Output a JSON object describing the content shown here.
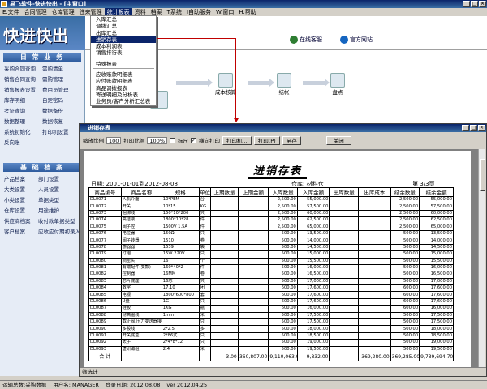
{
  "window": {
    "title": "易飞软件-快进快出 - [主窗口]"
  },
  "menu": [
    "E.文件",
    "合同管理",
    "仓库管理",
    "往来管理",
    "统计报表",
    "资料",
    "档案",
    "T系统",
    "I自助服务",
    "W.窗口",
    "H.帮助"
  ],
  "logo": "快进快出",
  "banner": {
    "service": "在线客服",
    "website": "官方网站"
  },
  "dropdown": {
    "group1": [
      "入库汇总",
      "调拨汇总",
      "出库汇总",
      "进销存表",
      "成本利润表",
      "销售排行表"
    ],
    "group2": [
      "特殊报表"
    ],
    "group3": [
      "应收账款明细表",
      "应付账款明细表",
      "商品调拨报表",
      "寄送明细及分析表",
      "业务员/客户分析汇总表"
    ],
    "selected": "进销存表"
  },
  "sidebar": {
    "daily_title": "日 常 业 务",
    "daily_items": [
      "采购合同查询",
      "需购清单",
      "销售合同查询",
      "需购管理",
      "销售报表设置",
      "费用员管理",
      "库存明细",
      "自定密码",
      "考证查询",
      "数据备份",
      "数据整理",
      "数据恢复",
      "系统初始化",
      "打印机设置",
      "反向账"
    ],
    "basic_title": "基 础 档 案",
    "basic_items": [
      "产品档案",
      "部门设置",
      "大类设置",
      "人员设置",
      "小类设置",
      "单据类型",
      "仓库设置",
      "用途维护",
      "供应商档案",
      "收付款单据类型",
      "客户档案",
      "应收应付期初录入"
    ]
  },
  "flow": {
    "cost": "成本核算",
    "settle": "结帐",
    "cash": "盘点"
  },
  "child": {
    "title": "进销存表",
    "toolbar": {
      "display_label": "缩放比例",
      "display_val": "100",
      "print_label": "打印比例",
      "print_val": "100%",
      "ruler": "标尺",
      "landscape": "横向打印",
      "print_setup": "打印机...",
      "print": "打印(P)",
      "saveas": "另存",
      "close": "关闭"
    },
    "report_title": "进销存表",
    "date_range": "日期: 2001-01-01到2012-08-08",
    "warehouse": "仓库:    材料仓",
    "page": "第 3/3页",
    "headers": [
      "商品编号",
      "商品名称",
      "规格",
      "单位",
      "上期数量",
      "上期金额",
      "入库数量",
      "入库金额",
      "出库数量",
      "出库成本",
      "结余数量",
      "结余金额"
    ],
    "rows": [
      [
        "DL0071",
        "人机介面",
        "10*PEM",
        "台",
        "",
        "",
        "2,500.00",
        "55,000.00",
        "",
        "",
        "2,500.00",
        "55,000.00"
      ],
      [
        "DL0072",
        "开关",
        "10*15",
        "KG",
        "",
        "",
        "2,500.00",
        "57,500.00",
        "",
        "",
        "2,500.00",
        "57,500.00"
      ],
      [
        "DL0073",
        "捆绑线",
        "150*10*200",
        "只",
        "",
        "",
        "2,500.00",
        "60,000.00",
        "",
        "",
        "2,500.00",
        "60,000.00"
      ],
      [
        "DL0074",
        "高洁液",
        "1800*10*28",
        "件",
        "",
        "",
        "2,500.00",
        "62,500.00",
        "",
        "",
        "2,500.00",
        "62,500.00"
      ],
      [
        "DL0075",
        "阀子控",
        "1500V 1.5A",
        "件",
        "",
        "",
        "2,500.00",
        "65,000.00",
        "",
        "",
        "2,500.00",
        "65,000.00"
      ],
      [
        "DL0076",
        "电位器",
        "150Ω",
        "只",
        "",
        "",
        "500.00",
        "13,500.00",
        "",
        "",
        "500.00",
        "13,500.00"
      ],
      [
        "DL0077",
        "阀子转器",
        "1510",
        "卷",
        "",
        "",
        "500.00",
        "14,000.00",
        "",
        "",
        "500.00",
        "14,000.00"
      ],
      [
        "DL0078",
        "感器器",
        "1539",
        "袋",
        "",
        "",
        "500.00",
        "14,500.00",
        "",
        "",
        "500.00",
        "14,500.00"
      ],
      [
        "DL0079",
        "灯泡",
        "15W 220V",
        "只",
        "",
        "",
        "500.00",
        "15,000.00",
        "",
        "",
        "500.00",
        "15,000.00"
      ],
      [
        "DL0080",
        "稠密头",
        "16",
        "个",
        "",
        "",
        "500.00",
        "15,500.00",
        "",
        "",
        "500.00",
        "15,500.00"
      ],
      [
        "DL0081",
        "有端配件(变款)",
        "160*40*2",
        "件",
        "",
        "",
        "500.00",
        "16,000.00",
        "",
        "",
        "500.00",
        "16,000.00"
      ],
      [
        "DL0082",
        "控制器",
        "16MM",
        "卷",
        "",
        "",
        "500.00",
        "16,500.00",
        "",
        "",
        "500.00",
        "16,500.00"
      ],
      [
        "DL0083",
        "芯片底座",
        "16芯",
        "只",
        "",
        "",
        "500.00",
        "17,000.00",
        "",
        "",
        "500.00",
        "17,000.00"
      ],
      [
        "DL0084",
        "数字",
        "17.10",
        "团",
        "",
        "",
        "600.00",
        "17,600.00",
        "",
        "",
        "600.00",
        "17,600.00"
      ],
      [
        "DL0085",
        "电视",
        "1800*600*800",
        "套",
        "",
        "",
        "600.00",
        "17,600.00",
        "",
        "",
        "600.00",
        "17,600.00"
      ],
      [
        "DL0086",
        "U盘",
        "1G",
        "只",
        "",
        "",
        "600.00",
        "17,600.00",
        "",
        "",
        "600.00",
        "17,600.00"
      ],
      [
        "DL0087",
        "硅胶",
        "1KG",
        "瓶",
        "",
        "",
        "600.00",
        "16,000.00",
        "",
        "",
        "600.00",
        "16,000.00"
      ],
      [
        "DL0088",
        "耐高温线",
        "1mm",
        "米",
        "",
        "",
        "500.00",
        "17,500.00",
        "",
        "",
        "500.00",
        "17,500.00"
      ],
      [
        "DL0089",
        "截止阀,压力变送器接头",
        "",
        "只",
        "",
        "",
        "500.00",
        "17,500.00",
        "",
        "",
        "500.00",
        "17,500.00"
      ],
      [
        "DL0090",
        "多股线",
        "2*2.5",
        "多",
        "",
        "",
        "500.00",
        "18,000.00",
        "",
        "",
        "500.00",
        "18,000.00"
      ],
      [
        "DL0091",
        "开关底盒",
        "2*86式",
        "只",
        "",
        "",
        "500.00",
        "18,500.00",
        "",
        "",
        "500.00",
        "18,500.00"
      ],
      [
        "DL0092",
        "太子",
        "2*4*8*12",
        "只",
        "",
        "",
        "500.00",
        "19,000.00",
        "",
        "",
        "500.00",
        "19,000.00"
      ],
      [
        "DL0093",
        "虚研磁组",
        "2.4",
        "米",
        "",
        "",
        "500.00",
        "19,500.00",
        "",
        "",
        "500.00",
        "19,500.00"
      ]
    ],
    "total": [
      "合    计",
      "",
      "",
      "",
      "3.00",
      "360,807.00",
      "9,110,063.00",
      "9,832.00",
      "",
      "369,280.00",
      "369,285.00",
      "9,739,694.70"
    ],
    "status": "筛选计"
  },
  "status_bar": [
    "运输总数:采购数据",
    "用户名: MANAGER",
    "登录日期: 2012.08.08",
    "ver 2012.04.25"
  ]
}
